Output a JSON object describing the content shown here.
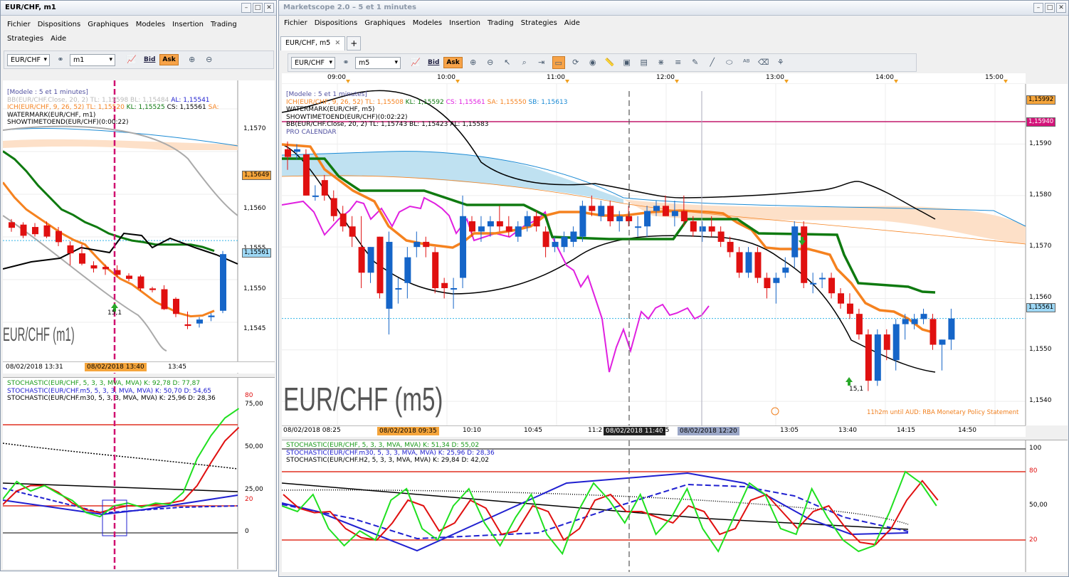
{
  "left": {
    "title": "EUR/CHF, m1",
    "menu": [
      "Fichier",
      "Dispositions",
      "Graphiques",
      "Modeles",
      "Insertion",
      "Trading",
      "Strategies",
      "Aide"
    ],
    "toolbar": {
      "instrument": "EUR/CHF",
      "period": "m1",
      "bid": "Bid",
      "ask": "Ask"
    },
    "info": {
      "model": "[Modele : 5 et 1 minutes]",
      "bb": "BB(EUR/CHF.Close, 20, 2)  TL: 1,15598  BL: 1,15484",
      "bb_al": "AL: 1,15541",
      "ich": "ICH(EUR/CHF, 9, 26, 52)  TL: 1,15520",
      "ich_kl": "KL: 1,15525",
      "ich_cs": "CS: 1,15561",
      "ich_sa": "SA:",
      "wm": "WATERMARK(EUR/CHF, m1)",
      "stt": "SHOWTIMETOEND(EUR/CHF)(0:00:22)"
    },
    "price_ticks": [
      "1,1570",
      "1,1560",
      "1,1555",
      "1,1550",
      "1,1545"
    ],
    "tags": {
      "orange": "1,15649",
      "blue": "1,15561"
    },
    "watermark": "EUR/CHF (m1)",
    "arrow_label": "15,1",
    "dates": [
      "08/02/2018 13:31",
      "08/02/2018 13:40",
      "13:45"
    ],
    "osc_info": [
      "STOCHASTIC(EUR/CHF, 5, 3, 3, MVA, MVA)  K: 92,78  D: 77,87",
      "STOCHASTIC(EUR/CHF.m5, 5, 3, 3, MVA, MVA)  K: 50,70  D: 54,65",
      "STOCHASTIC(EUR/CHF.m30, 5, 3, 3, MVA, MVA)  K: 25,96  D: 28,36"
    ],
    "osc_ticks": [
      "75,00",
      "50,00",
      "25,00"
    ],
    "osc_tags": [
      "80",
      "20",
      "0"
    ]
  },
  "right": {
    "title": "Marketscope 2.0 – 5 et 1 minutes",
    "menu": [
      "Fichier",
      "Dispositions",
      "Graphiques",
      "Modeles",
      "Insertion",
      "Trading",
      "Strategies",
      "Aide"
    ],
    "tab": "EUR/CHF, m5",
    "toolbar": {
      "instrument": "EUR/CHF",
      "period": "m5",
      "bid": "Bid",
      "ask": "Ask"
    },
    "time_ticks": [
      "09:00",
      "10:00",
      "11:00",
      "12:00",
      "13:00",
      "14:00",
      "15:00"
    ],
    "info": {
      "model": "[Modele : 5 et 1 minutes]",
      "ich": "ICH(EUR/CHF, 9, 26, 52)  TL: 1,15508",
      "ich_kl": "KL: 1,15592",
      "ich_cs": "CS: 1,15561",
      "ich_sa": "SA: 1,15550",
      "ich_sb": "SB: 1,15613",
      "wm": "WATERMARK(EUR/CHF, m5)",
      "stt": "SHOWTIMETOEND(EUR/CHF)(0:02:22)",
      "bb": "BB(EUR/CHF.Close, 20, 2)  TL: 1,15743  BL: 1,15423  AL: 1,15583",
      "cal": "PRO CALENDAR"
    },
    "price_ticks": [
      "1,1590",
      "1,1580",
      "1,1570",
      "1,1560",
      "1,1550",
      "1,1540"
    ],
    "tags": {
      "orange": "1,15992",
      "pink": "1,15940",
      "blue": "1,15561"
    },
    "watermark": "EUR/CHF (m5)",
    "arrow_label": "15,1",
    "news": "11h2m until AUD: RBA Monetary Policy Statement",
    "dates": [
      "08/02/2018 08:25",
      "08/02/2018 09:35",
      "10:10",
      "10:45",
      "11:2",
      "08/02/2018 11:40",
      "35",
      "08/02/2018 12:20",
      "13:05",
      "13:40",
      "14:15",
      "14:50"
    ],
    "osc_info": [
      "STOCHASTIC(EUR/CHF, 5, 3, 3, MVA, MVA)  K: 51,34  D: 55,02",
      "STOCHASTIC(EUR/CHF.m30, 5, 3, 3, MVA, MVA)  K: 25,96  D: 28,36",
      "STOCHASTIC(EUR/CHF.H2, 5, 3, 3, MVA, MVA)  K: 29,84  D: 42,02"
    ],
    "osc_ticks": [
      "50,00"
    ],
    "osc_tags": [
      "100",
      "80",
      "20"
    ]
  },
  "colors": {
    "bull": "#1565c8",
    "bear": "#e01010",
    "kijun": "#0f7a10",
    "tenkan": "#f5821f",
    "chikou": "#e020e0",
    "bb": "#000000",
    "cloud_up": "#bfe1f1",
    "cloud_dn": "#fde0c8",
    "sa": "#1a8ad4",
    "price_line": "#32b4e6"
  },
  "chart_data": [
    {
      "type": "candlestick",
      "title": "EUR/CHF (m1)",
      "ylim": [
        1.1543,
        1.1575
      ],
      "candles": [
        [
          1.15584,
          1.15588,
          1.15572,
          1.15577
        ],
        [
          1.15581,
          1.15584,
          1.15564,
          1.15567
        ],
        [
          1.15578,
          1.15583,
          1.15566,
          1.15569
        ],
        [
          1.1558,
          1.15585,
          1.15564,
          1.15566
        ],
        [
          1.15573,
          1.15578,
          1.15554,
          1.15559
        ],
        [
          1.15555,
          1.1556,
          1.1553,
          1.15545
        ],
        [
          1.15545,
          1.15556,
          1.1553,
          1.15532
        ],
        [
          1.1553,
          1.15535,
          1.15521,
          1.15526
        ],
        [
          1.15528,
          1.15531,
          1.15518,
          1.15525
        ],
        [
          1.15524,
          1.1553,
          1.15515,
          1.15518
        ],
        [
          1.15517,
          1.1552,
          1.1551,
          1.15513
        ],
        [
          1.15516,
          1.15518,
          1.15498,
          1.15501
        ],
        [
          1.15501,
          1.15503,
          1.15496,
          1.15499
        ],
        [
          1.155,
          1.15505,
          1.15474,
          1.15475
        ],
        [
          1.15488,
          1.1549,
          1.15465,
          1.15469
        ],
        [
          1.15456,
          1.15472,
          1.1545,
          1.15454
        ],
        [
          1.15457,
          1.15465,
          1.15452,
          1.15462
        ],
        [
          1.15465,
          1.1547,
          1.1546,
          1.15467
        ],
        [
          1.15473,
          1.15548,
          1.1547,
          1.15544
        ]
      ],
      "tenkan": [
        1.15634,
        1.15615,
        1.156,
        1.1559,
        1.1558,
        1.1557,
        1.15562,
        1.15556,
        1.1554,
        1.15525,
        1.15513,
        1.15506,
        1.15495,
        1.15484,
        1.15477,
        1.1547,
        1.15466,
        1.15467,
        1.15473
      ],
      "kijun": [
        1.15673,
        1.15663,
        1.15648,
        1.1563,
        1.15615,
        1.156,
        1.15593,
        1.15584,
        1.15578,
        1.1557,
        1.15565,
        1.15561,
        1.15559,
        1.15556,
        1.15556,
        1.15556,
        1.15556,
        1.15553,
        1.15548
      ],
      "stoch_k": [
        25,
        38,
        31,
        35,
        29,
        24,
        15,
        12,
        20,
        22,
        19,
        22,
        21,
        30,
        55,
        72,
        85,
        92
      ],
      "stoch_d": [
        21,
        31,
        35,
        35,
        30,
        22,
        17,
        15,
        18,
        20,
        20,
        21,
        22,
        24,
        35,
        52,
        68,
        78
      ]
    },
    {
      "type": "candlestick",
      "title": "EUR/CHF (m5)",
      "ylim": [
        1.1536,
        1.1601
      ],
      "candles": [
        [
          1.1589,
          1.15905,
          1.1585,
          1.15875
        ],
        [
          1.15885,
          1.159,
          1.1587,
          1.1589
        ],
        [
          1.1588,
          1.1589,
          1.158,
          1.158
        ],
        [
          1.158,
          1.1582,
          1.1579,
          1.158
        ],
        [
          1.1583,
          1.1584,
          1.1579,
          1.158
        ],
        [
          1.15795,
          1.1581,
          1.1575,
          1.1576
        ],
        [
          1.15765,
          1.1578,
          1.1573,
          1.1574
        ],
        [
          1.1574,
          1.1576,
          1.157,
          1.1572
        ],
        [
          1.157,
          1.1576,
          1.1562,
          1.1565
        ],
        [
          1.1565,
          1.157,
          1.1563,
          1.157
        ],
        [
          1.1572,
          1.1572,
          1.156,
          1.1561
        ],
        [
          1.1558,
          1.1573,
          1.1553,
          1.1571
        ],
        [
          1.1562,
          1.1564,
          1.1559,
          1.1562
        ],
        [
          1.1563,
          1.157,
          1.156,
          1.1568
        ],
        [
          1.157,
          1.1573,
          1.1568,
          1.1571
        ],
        [
          1.1571,
          1.1572,
          1.1568,
          1.157
        ],
        [
          1.1569,
          1.157,
          1.1561,
          1.1562
        ],
        [
          1.1563,
          1.1564,
          1.156,
          1.1562
        ],
        [
          1.1562,
          1.1564,
          1.1558,
          1.1562
        ],
        [
          1.1564,
          1.158,
          1.1562,
          1.1576
        ],
        [
          1.1575,
          1.1576,
          1.1572,
          1.1573
        ],
        [
          1.1573,
          1.1576,
          1.1571,
          1.1574
        ],
        [
          1.1574,
          1.1576,
          1.1572,
          1.1575
        ],
        [
          1.1575,
          1.1578,
          1.1573,
          1.1574
        ],
        [
          1.1574,
          1.1576,
          1.1572,
          1.1573
        ],
        [
          1.1572,
          1.1575,
          1.1571,
          1.1574
        ],
        [
          1.1574,
          1.1577,
          1.1573,
          1.1576
        ],
        [
          1.1576,
          1.1577,
          1.1573,
          1.1574
        ],
        [
          1.1573,
          1.1574,
          1.1568,
          1.157
        ],
        [
          1.157,
          1.1572,
          1.1569,
          1.1571
        ],
        [
          1.157,
          1.1573,
          1.1569,
          1.1572
        ],
        [
          1.1571,
          1.1574,
          1.157,
          1.1573
        ],
        [
          1.1572,
          1.1579,
          1.1571,
          1.1578
        ],
        [
          1.1578,
          1.158,
          1.1576,
          1.1577
        ],
        [
          1.1576,
          1.1579,
          1.1575,
          1.1578
        ],
        [
          1.1578,
          1.1579,
          1.1574,
          1.1575
        ],
        [
          1.1575,
          1.1577,
          1.1573,
          1.1576
        ],
        [
          1.1576,
          1.1578,
          1.1574,
          1.1575
        ],
        [
          1.1574,
          1.1576,
          1.1572,
          1.1574
        ],
        [
          1.1574,
          1.1578,
          1.1572,
          1.1577
        ],
        [
          1.1577,
          1.1579,
          1.1576,
          1.1578
        ],
        [
          1.1578,
          1.158,
          1.1576,
          1.1576
        ],
        [
          1.1576,
          1.1579,
          1.1574,
          1.1577
        ],
        [
          1.1577,
          1.158,
          1.1574,
          1.1575
        ],
        [
          1.1575,
          1.1576,
          1.1572,
          1.1573
        ],
        [
          1.1573,
          1.1575,
          1.1571,
          1.1574
        ],
        [
          1.1574,
          1.1576,
          1.1572,
          1.1573
        ],
        [
          1.1573,
          1.1574,
          1.157,
          1.1571
        ],
        [
          1.1571,
          1.1572,
          1.1568,
          1.1569
        ],
        [
          1.1569,
          1.157,
          1.1564,
          1.1565
        ],
        [
          1.1565,
          1.157,
          1.1564,
          1.1569
        ],
        [
          1.1569,
          1.157,
          1.1563,
          1.1564
        ],
        [
          1.1564,
          1.1565,
          1.156,
          1.1562
        ],
        [
          1.1563,
          1.1565,
          1.1559,
          1.1564
        ],
        [
          1.1565,
          1.1568,
          1.1564,
          1.1566
        ],
        [
          1.1568,
          1.1575,
          1.1566,
          1.1574
        ],
        [
          1.1574,
          1.1575,
          1.1562,
          1.1563
        ],
        [
          1.1563,
          1.1565,
          1.1561,
          1.1563
        ],
        [
          1.1564,
          1.1565,
          1.1562,
          1.1564
        ],
        [
          1.1564,
          1.1565,
          1.156,
          1.1561
        ],
        [
          1.1561,
          1.1562,
          1.1558,
          1.1559
        ],
        [
          1.1559,
          1.1561,
          1.1556,
          1.1557
        ],
        [
          1.1557,
          1.1558,
          1.1552,
          1.1553
        ],
        [
          1.1553,
          1.1554,
          1.1542,
          1.1544
        ],
        [
          1.1544,
          1.1554,
          1.1543,
          1.1553
        ],
        [
          1.1553,
          1.1554,
          1.1548,
          1.155
        ],
        [
          1.1548,
          1.1556,
          1.1546,
          1.1555
        ],
        [
          1.1555,
          1.1557,
          1.1552,
          1.1556
        ],
        [
          1.1555,
          1.1557,
          1.1554,
          1.1556
        ],
        [
          1.1556,
          1.1558,
          1.1555,
          1.1557
        ],
        [
          1.1556,
          1.1557,
          1.155,
          1.1551
        ],
        [
          1.1551,
          1.1552,
          1.1546,
          1.1552
        ],
        [
          1.1552,
          1.1558,
          1.155,
          1.15561
        ]
      ],
      "stoch_k": [
        50,
        45,
        60,
        30,
        15,
        28,
        20,
        55,
        65,
        30,
        20,
        50,
        65,
        35,
        15,
        40,
        60,
        25,
        8,
        45,
        70,
        55,
        35,
        60,
        25,
        40,
        65,
        30,
        10,
        40,
        70,
        60,
        30,
        25,
        65,
        40,
        20,
        10,
        15,
        45,
        80,
        70,
        50
      ],
      "stoch_d": [
        60,
        48,
        44,
        45,
        30,
        22,
        20,
        35,
        55,
        50,
        28,
        35,
        55,
        48,
        25,
        28,
        50,
        45,
        20,
        30,
        55,
        60,
        45,
        45,
        40,
        35,
        50,
        45,
        25,
        30,
        55,
        60,
        45,
        30,
        45,
        50,
        32,
        18,
        16,
        30,
        55,
        72,
        55
      ]
    }
  ]
}
